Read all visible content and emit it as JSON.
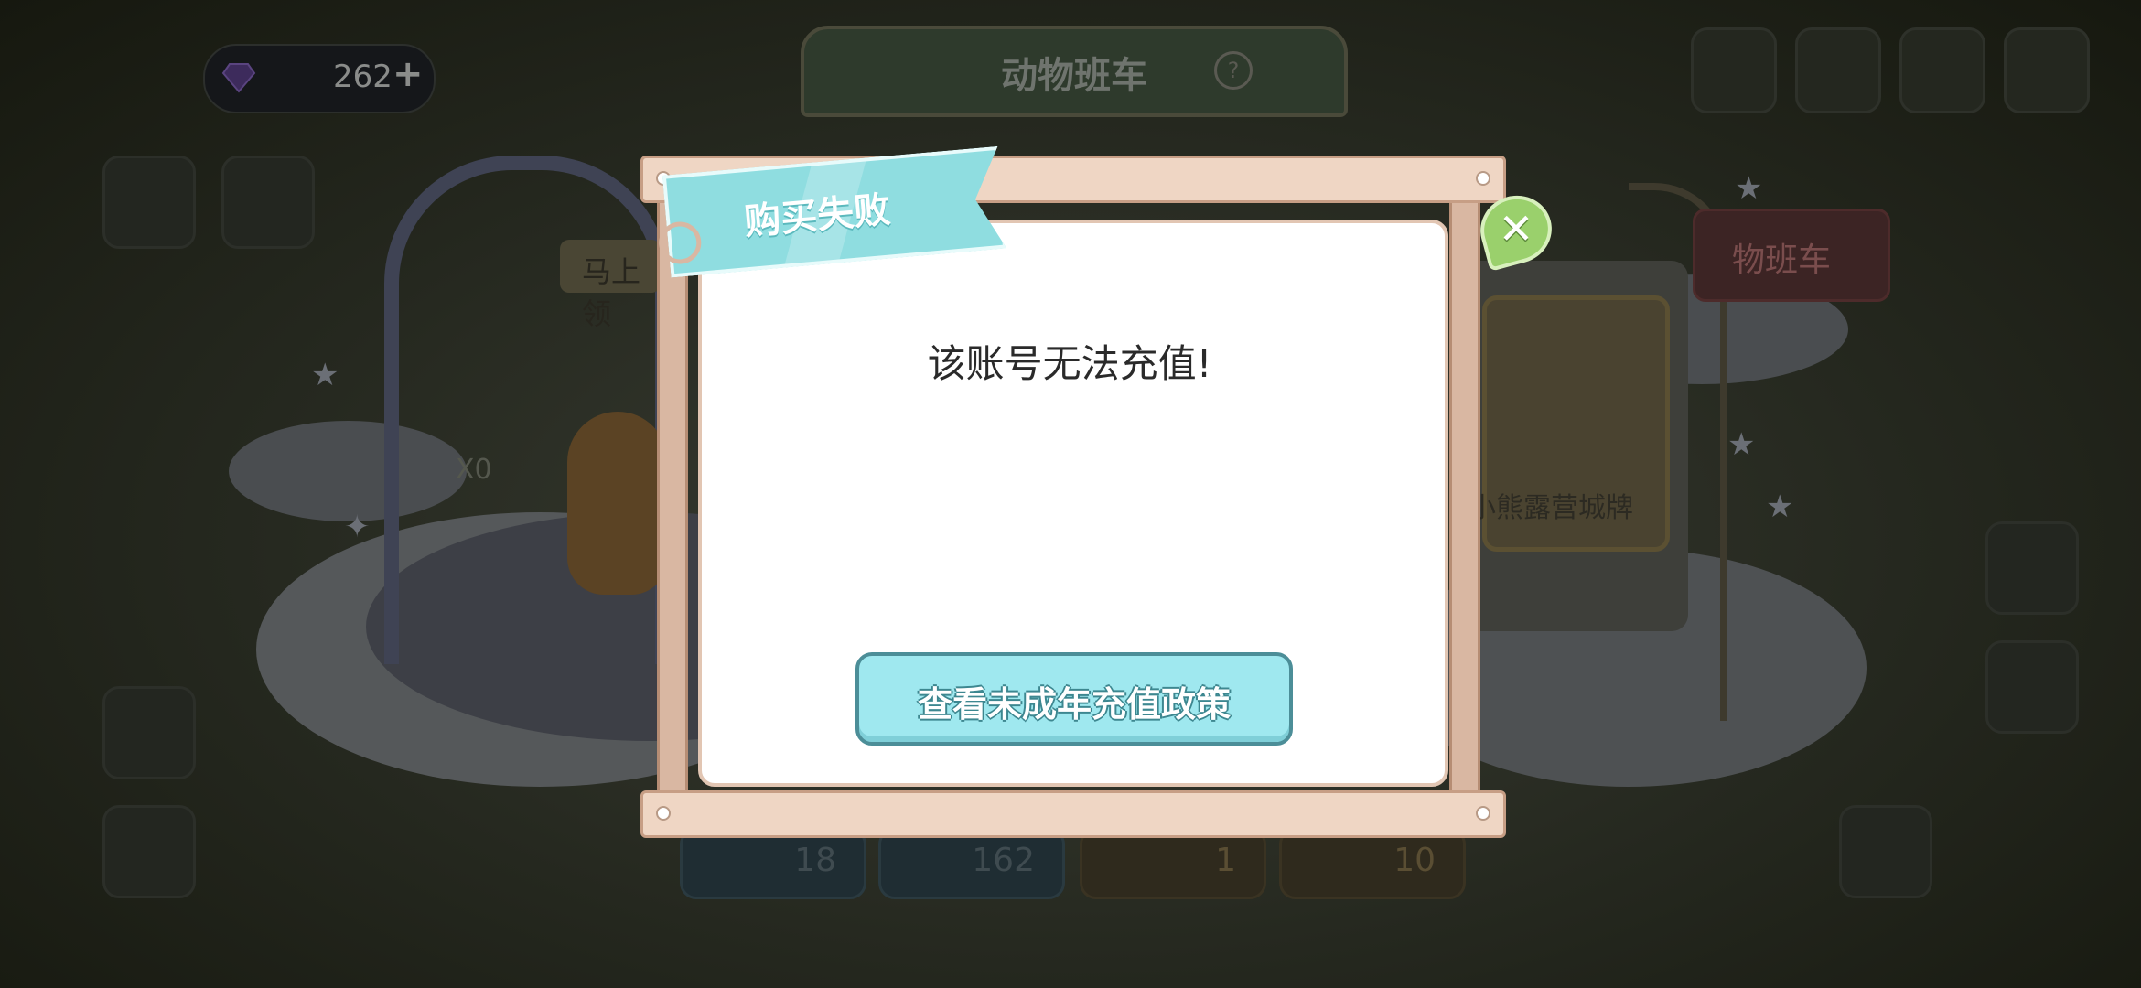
{
  "background": {
    "currency_count": "262",
    "title": "动物班车",
    "left_tag": "马上领",
    "xo_label": "X0",
    "right_card_label": "小熊露营城牌",
    "right_tab_label": "物班车",
    "bottom_tabs": [
      "18",
      "162",
      "1",
      "10"
    ]
  },
  "dialog": {
    "title": "购买失败",
    "message": "该账号无法充值!",
    "button_label": "查看未成年充值政策"
  },
  "colors": {
    "ribbon": "#8fdde0",
    "button": "#9fe8ef",
    "close_leaf": "#9ad06c",
    "board": "#efd6c4"
  },
  "icons": [
    "gem-icon",
    "plus-icon",
    "help-icon",
    "close-icon"
  ]
}
